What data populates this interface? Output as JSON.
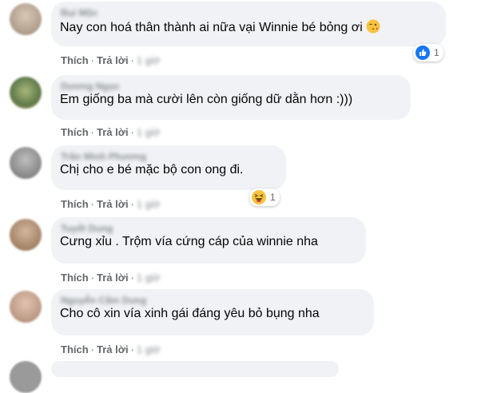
{
  "comments": [
    {
      "author": "Bụi Mộc",
      "text": "Nay con hoá thân thành ai nữa vại Winnie bé bỏng ơi",
      "like": "Thích",
      "reply": "Trả lời",
      "time": "1 giờ",
      "reaction": {
        "type": "like",
        "count": "1"
      }
    },
    {
      "author": "Dương Ngọc",
      "text": "Em giống ba mà cười lên còn giống dữ dằn hơn :)))",
      "like": "Thích",
      "reply": "Trả lời",
      "time": "1 giờ"
    },
    {
      "author": "Trần Minh Phương",
      "text": "Chị cho e bé mặc bộ con ong đi.",
      "like": "Thích",
      "reply": "Trả lời",
      "time": "1 giờ",
      "reaction": {
        "type": "haha",
        "count": "1"
      }
    },
    {
      "author": "Tuyết Dung",
      "text": "Cưng xỉu . Trộm vía cứng cáp của winnie nha",
      "like": "Thích",
      "reply": "Trả lời",
      "time": "1 giờ"
    },
    {
      "author": "Nguyễn Cẩm Dung",
      "text": "Cho cô xin vía xinh gái đáng yêu bỏ bụng nha",
      "like": "Thích",
      "reply": "Trả lời",
      "time": "1 giờ"
    }
  ],
  "colors": {
    "bubble": "#f0f2f5",
    "like_blue": "#1877f2",
    "emoji_yellow": "#f7c33e"
  }
}
